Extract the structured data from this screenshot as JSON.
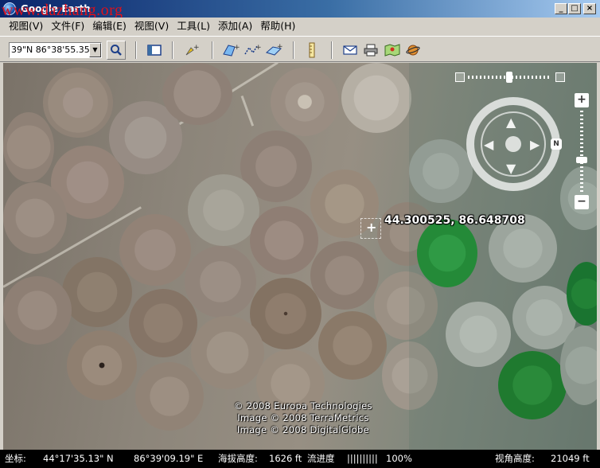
{
  "window": {
    "title": "Google Earth",
    "watermark": "www.dazhang.org",
    "controls": [
      "_",
      "□",
      "×"
    ]
  },
  "menu": {
    "items": [
      "视图(V)",
      "文件(F)",
      "编辑(E)",
      "视图(V)",
      "工具(L)",
      "添加(A)",
      "帮助(H)"
    ]
  },
  "toolbar": {
    "search_value": "39\"N 86°38'55.35\"E",
    "buttons": [
      {
        "name": "search-icon",
        "glyph": "🔍"
      },
      {
        "name": "sidebar-toggle-icon",
        "glyph": "▭"
      },
      {
        "name": "placemark-icon",
        "glyph": "📌"
      },
      {
        "name": "polygon-icon",
        "glyph": "⬠"
      },
      {
        "name": "path-icon",
        "glyph": "✎"
      },
      {
        "name": "image-overlay-icon",
        "glyph": "▱"
      },
      {
        "name": "ruler-icon",
        "glyph": "📏"
      },
      {
        "name": "email-icon",
        "glyph": "✉"
      },
      {
        "name": "print-icon",
        "glyph": "🖶"
      },
      {
        "name": "maps-icon",
        "glyph": "🗺"
      },
      {
        "name": "sky-icon",
        "glyph": "🪐"
      }
    ]
  },
  "map": {
    "coordinate_label": "44.300525, 86.648708",
    "credits": [
      "© 2008 Europa Technologies",
      "Image © 2008 TerraMetrics",
      "Image © 2008 DigitalGlobe"
    ],
    "nav_north": "N",
    "zoom_in": "+",
    "zoom_out": "−"
  },
  "statusbar": {
    "coord_label": "坐标:",
    "latitude": "44°17'35.13\" N",
    "longitude": "86°39'09.19\" E",
    "elevation_label": "海拔高度:",
    "elevation": "1626 ft",
    "streaming_label": "流进度",
    "streaming_bar": "||||||||||",
    "streaming_pct": "100%",
    "eye_alt_label": "视角高度:",
    "eye_alt": "21049 ft"
  },
  "colors": {
    "titlebar_start": "#0a246a",
    "chrome": "#d4d0c8",
    "watermark": "#e0101a",
    "green_field": "#2a8a3a"
  }
}
